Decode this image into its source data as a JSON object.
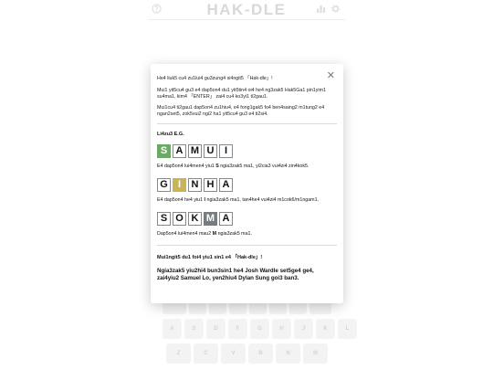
{
  "header": {
    "title": "HAK-DLE"
  },
  "keyboard": {
    "row1": [
      "",
      "",
      "",
      "",
      "",
      "",
      "",
      "",
      "",
      "",
      ""
    ],
    "row2": [
      "A",
      "S",
      "D",
      "F",
      "G",
      "H",
      "J",
      "K",
      "L"
    ],
    "row3": [
      "Z",
      "C",
      "V",
      "B",
      "N",
      "M"
    ]
  },
  "modal": {
    "intro": "He4 liuk5 cu4 zu1lui4 gu3zung4 si4ngit5 「Hak-dle」!",
    "rule1": "Mui1 yit5cu4 gu3 e4 dap5on4 du1 yit5tin4 oi4 he4 ng3zak5 Hak5Ga1 pin1yim1 su4ma1, kim4 「ENTER」 zai4 cu4 ko3yi1 ti2gau1.",
    "rule2": "Mui1cu4 ti2gau1 dap5on4 zu1hiu4, e4 fong1gak5 fo4 ben4saing2 m1tung2 e4 ngan2set5, zok5vui2 ngi2 ha1 yit5cu4 gu3 e4 ti2si4.",
    "examples_heading": "Li4zu3 E.G.",
    "examples": [
      {
        "letters": [
          "S",
          "A",
          "M",
          "U",
          "I"
        ],
        "states": [
          "correct",
          "empty",
          "empty",
          "empty",
          "empty"
        ],
        "before": "E4 dap5on4 lui4men4 yiu1 ",
        "letter": "S",
        "after": " ngia3zak5 ma1, yi2cia3 vui4zi4 zin4kok5."
      },
      {
        "letters": [
          "G",
          "I",
          "N",
          "H",
          "A"
        ],
        "states": [
          "empty",
          "present",
          "empty",
          "empty",
          "empty"
        ],
        "before": "E4 dap5on4 he4 yiu1 ",
        "letter": "I",
        "after": " ngia3zak5 ma1, tan4he4 vui4zi4 m1cok6/m1ngam1."
      },
      {
        "letters": [
          "S",
          "O",
          "K",
          "M",
          "A"
        ],
        "states": [
          "empty",
          "empty",
          "empty",
          "absent",
          "empty"
        ],
        "before": "Dap5on4 lui4men4 mau2 ",
        "letter": "M",
        "after": " ngia3zak5 ma1."
      }
    ],
    "note": "Mui1ngit5 du1 foi4 yiu1 sin1 e4 「Hak-dle」!",
    "credits": "Ngia3zak5 yiu2hi4 bun3sin1 he4 Josh Wardle set5ge4 ge4, zai4yiu2 Samuel Lo, yen2hiu4 Dylan Sung goi3 ban3."
  }
}
